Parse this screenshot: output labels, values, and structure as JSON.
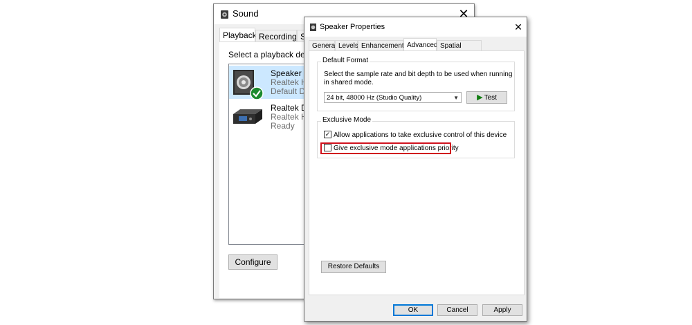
{
  "sound_window": {
    "title": "Sound",
    "close_glyph": "✕",
    "tabs": [
      {
        "label": "Playback",
        "active": true
      },
      {
        "label": "Recording",
        "active": false
      },
      {
        "label": "So",
        "active": false
      }
    ],
    "instructions": "Select a playback devic",
    "devices": [
      {
        "name": "Speaker",
        "sub1": "Realtek Hi",
        "sub2": "Default De",
        "selected": true,
        "icon": "speaker-icon"
      },
      {
        "name": "Realtek Di",
        "sub1": "Realtek Hi",
        "sub2": "Ready",
        "selected": false,
        "icon": "digital-output-icon"
      }
    ],
    "configure_label": "Configure"
  },
  "props_window": {
    "title": "Speaker Properties",
    "close_glyph": "✕",
    "tabs": [
      {
        "label": "General",
        "active": false
      },
      {
        "label": "Levels",
        "active": false
      },
      {
        "label": "Enhancements",
        "active": false
      },
      {
        "label": "Advanced",
        "active": true
      },
      {
        "label": "Spatial sound",
        "active": false
      }
    ],
    "default_format": {
      "group_label": "Default Format",
      "description": "Select the sample rate and bit depth to be used when running in shared mode.",
      "selected_format": "24 bit, 48000 Hz (Studio Quality)",
      "test_label": "Test"
    },
    "exclusive_mode": {
      "group_label": "Exclusive Mode",
      "allow_exclusive_label": "Allow applications to take exclusive control of this device",
      "allow_exclusive_checked": true,
      "priority_label": "Give exclusive mode applications priority",
      "priority_checked": false
    },
    "restore_defaults_label": "Restore Defaults",
    "ok_label": "OK",
    "cancel_label": "Cancel",
    "apply_label": "Apply"
  },
  "colors": {
    "highlight_border": "#d0111d",
    "selection_bg": "#cce8ff",
    "default_check": "#1b8a2e",
    "test_play": "#107c10"
  }
}
